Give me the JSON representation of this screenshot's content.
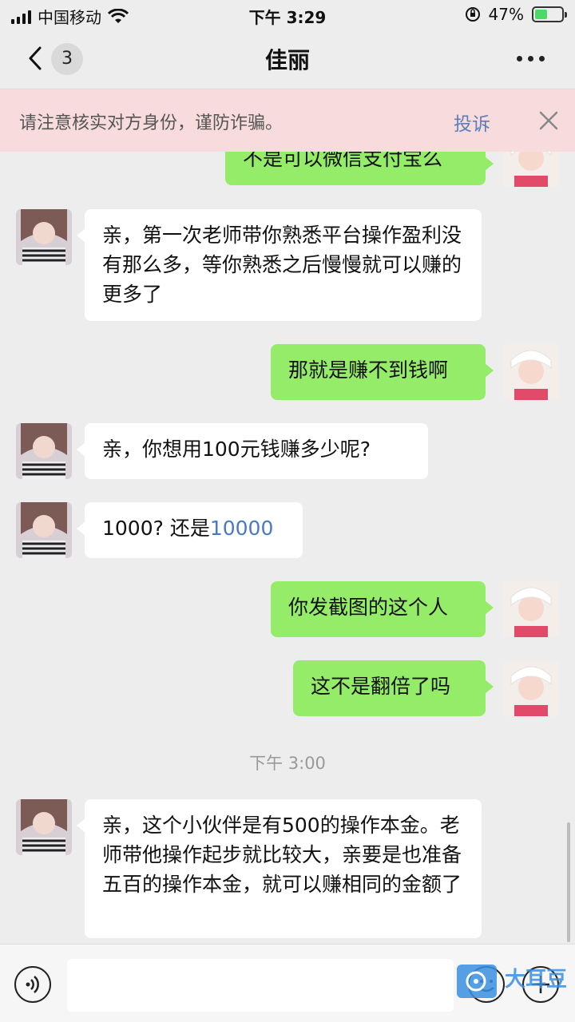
{
  "status_bar": {
    "carrier": "中国移动",
    "time": "下午 3:29",
    "battery_percent": "47%",
    "battery_level": 0.47,
    "icons": [
      "signal-icon",
      "wifi-icon",
      "rotation-lock-icon",
      "battery-icon"
    ]
  },
  "nav": {
    "unread_count": "3",
    "title": "佳丽"
  },
  "warning": {
    "text": "请注意核实对方身份，谨防诈骗。",
    "link": "投诉"
  },
  "messages": [
    {
      "side": "out",
      "text": "不是可以微信支付宝么"
    },
    {
      "side": "in",
      "text": "亲，第一次老师带你熟悉平台操作盈利没有那么多，等你熟悉之后慢慢就可以赚的更多了"
    },
    {
      "side": "out",
      "text": "那就是赚不到钱啊"
    },
    {
      "side": "in",
      "text": "亲，你想用100元钱赚多少呢?"
    },
    {
      "side": "in",
      "text_prefix": "1000?  还是",
      "text_link": "10000"
    },
    {
      "side": "out",
      "text": "你发截图的这个人"
    },
    {
      "side": "out",
      "text": "这不是翻倍了吗"
    },
    {
      "side": "time",
      "text": "下午 3:00"
    },
    {
      "side": "in",
      "text": "亲，这个小伙伴是有500的操作本金。老师带他操作起步就比较大，亲要是也准备五百的操作本金，就可以赚相同的金额了"
    }
  ],
  "input_bar": {
    "input_value": "",
    "icons": [
      "voice-icon",
      "emoji-icon",
      "plus-icon"
    ]
  },
  "watermark": {
    "text": "大耳豆"
  },
  "colors": {
    "outgoing_bubble": "#95ec69",
    "incoming_bubble": "#ffffff",
    "banner": "#f8dbdc",
    "link": "#5a7fb8"
  }
}
